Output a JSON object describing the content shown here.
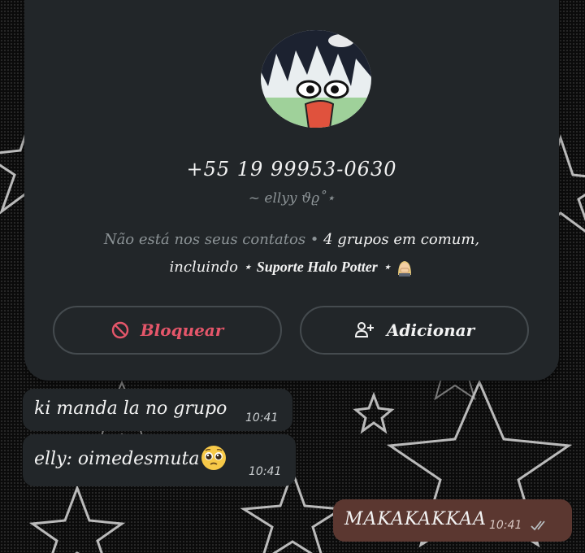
{
  "contact": {
    "phone": "+55 19 99953-0630",
    "nickname": "~ ellyy ϑϱ˚⋆",
    "not_in_contacts": "Não está nos seus contatos • ",
    "groups_common": "4 grupos em comum,",
    "including": "incluindo ⋆ ",
    "group_name": "Suporte Halo Potter",
    "group_suffix": " ⋆"
  },
  "actions": {
    "block_label": "Bloquear",
    "add_label": "Adicionar",
    "block_icon": "block-icon",
    "add_icon": "add-person-icon"
  },
  "messages": [
    {
      "text": "ki manda la no grupo",
      "time": "10:41",
      "direction": "incoming"
    },
    {
      "text": "elly: oimedesmuta",
      "emoji": "pleading-face",
      "time": "10:41",
      "direction": "incoming"
    },
    {
      "text": "MAKAKAKKAA",
      "time": "10:41",
      "direction": "outgoing",
      "status": "read"
    }
  ],
  "colors": {
    "card_bg": "#222629",
    "block_red": "#e5566a",
    "outgoing_bubble": "#5b3730",
    "muted_text": "#8c9396"
  }
}
